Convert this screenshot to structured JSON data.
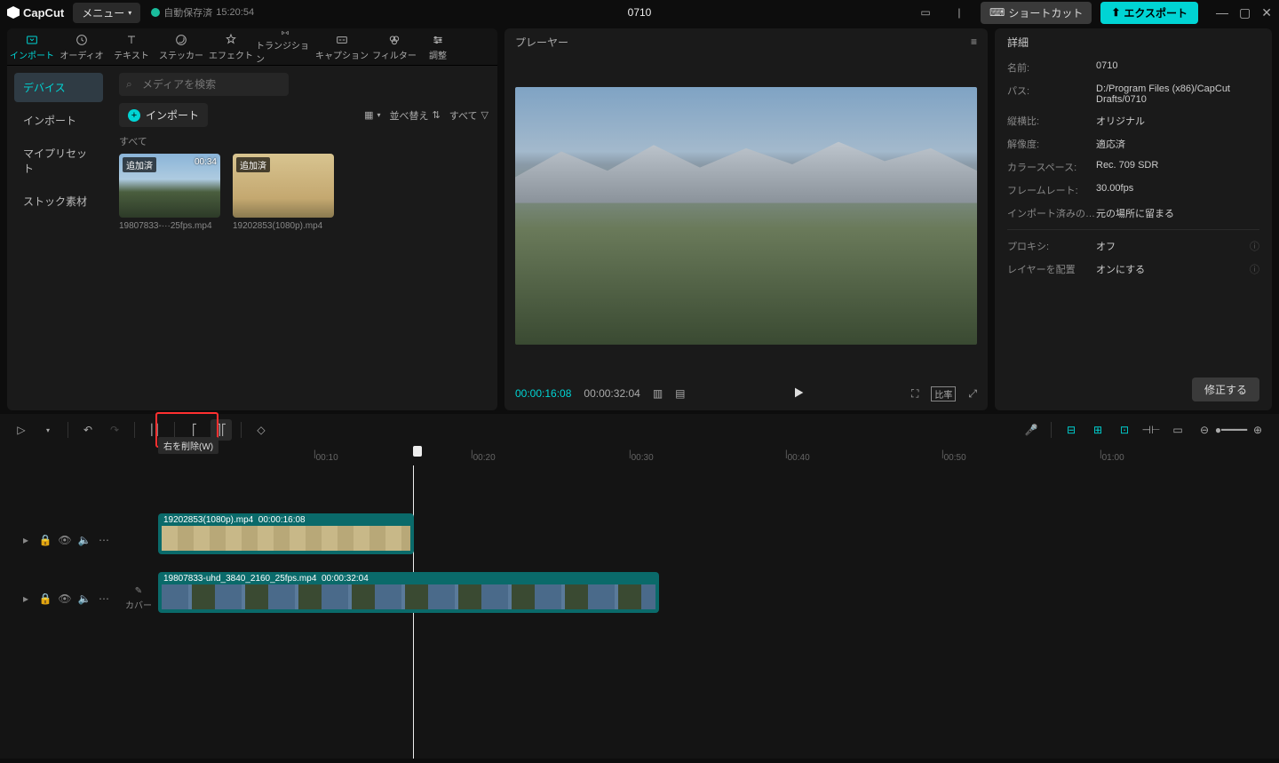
{
  "titlebar": {
    "logo_text": "CapCut",
    "menu_label": "メニュー",
    "autosave_label": "自動保存済",
    "autosave_time": "15:20:54",
    "project_title": "0710",
    "shortcut_label": "ショートカット",
    "export_label": "エクスポート"
  },
  "tool_tabs": {
    "import": "インポート",
    "audio": "オーディオ",
    "text": "テキスト",
    "sticker": "ステッカー",
    "effect": "エフェクト",
    "transition": "トランジション",
    "caption": "キャプション",
    "filter": "フィルター",
    "adjust": "調整"
  },
  "media": {
    "side_tabs": {
      "device": "デバイス",
      "import": "インポート",
      "presets": "マイプリセット",
      "stock": "ストック素材"
    },
    "search_placeholder": "メディアを検索",
    "import_button": "インポート",
    "sort_label": "並べ替え",
    "all_filter": "すべて",
    "section_label": "すべて",
    "clips": [
      {
        "badge": "追加済",
        "duration": "00:34",
        "name": "19807833-···25fps.mp4"
      },
      {
        "badge": "追加済",
        "duration": "",
        "name": "19202853(1080p).mp4"
      }
    ]
  },
  "player": {
    "title": "プレーヤー",
    "current_time": "00:00:16:08",
    "total_time": "00:00:32:04"
  },
  "details": {
    "title": "詳細",
    "rows": {
      "name_key": "名前:",
      "name_val": "0710",
      "path_key": "パス:",
      "path_val": "D:/Program Files (x86)/CapCut Drafts/0710",
      "aspect_key": "縦横比:",
      "aspect_val": "オリジナル",
      "res_key": "解像度:",
      "res_val": "適応済",
      "color_key": "カラースペース:",
      "color_val": "Rec. 709 SDR",
      "fps_key": "フレームレート:",
      "fps_val": "30.00fps",
      "imported_key": "インポート済みの…",
      "imported_val": "元の場所に留まる",
      "proxy_key": "プロキシ:",
      "proxy_val": "オフ",
      "layers_key": "レイヤーを配置",
      "layers_val": "オンにする"
    },
    "fix_button": "修正する"
  },
  "timeline": {
    "tooltip": "右を削除(W)",
    "ruler": [
      "00:10",
      "00:20",
      "00:30",
      "00:40",
      "00:50",
      "01:00"
    ],
    "cover_label": "カバー",
    "clip1": {
      "label": "19202853(1080p).mp4",
      "time": "00:00:16:08"
    },
    "clip2": {
      "label": "19807833-uhd_3840_2160_25fps.mp4",
      "time": "00:00:32:04"
    }
  }
}
